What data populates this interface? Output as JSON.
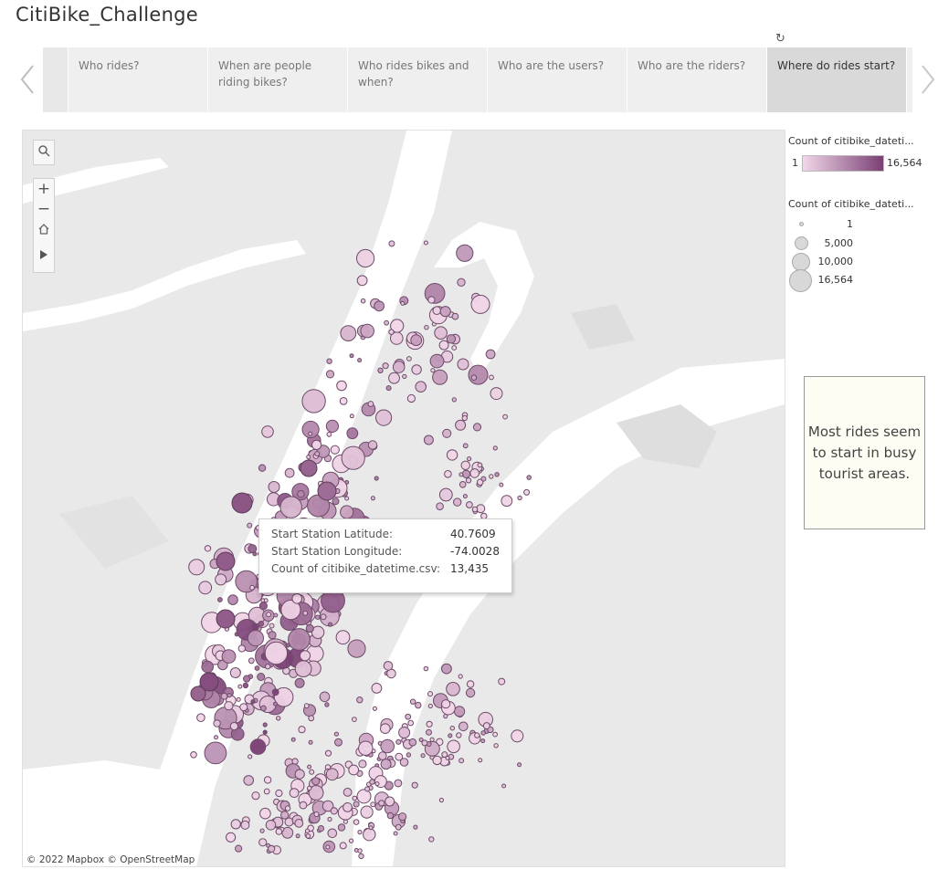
{
  "title": "CitiBike_Challenge",
  "story": {
    "tabs": [
      {
        "label": "Who rides?",
        "active": false
      },
      {
        "label": "When are people riding bikes?",
        "active": false
      },
      {
        "label": "Who rides bikes and when?",
        "active": false
      },
      {
        "label": "Who are the users?",
        "active": false
      },
      {
        "label": "Who are the riders?",
        "active": false
      },
      {
        "label": "Where do rides start?",
        "active": true
      }
    ]
  },
  "tooltip": {
    "rows": [
      {
        "key": "Start Station Latitude:",
        "value": "40.7609"
      },
      {
        "key": "Start Station Longitude:",
        "value": "-74.0028"
      },
      {
        "key": "Count of citibike_datetime.csv:",
        "value": "13,435"
      }
    ]
  },
  "map": {
    "credit": "© 2022 Mapbox  © OpenStreetMap",
    "tools": [
      "search-icon",
      "zoom-in-icon",
      "zoom-out-icon",
      "home-icon",
      "play-icon"
    ]
  },
  "legend": {
    "color_title": "Count of citibike_dateti...",
    "color_min": "1",
    "color_max": "16,564",
    "colors": {
      "low": "#f1d6e8",
      "high": "#7a3f74"
    },
    "size_title": "Count of citibike_dateti...",
    "size_items": [
      {
        "label": "1",
        "value": 1
      },
      {
        "label": "5,000",
        "value": 5000
      },
      {
        "label": "10,000",
        "value": 10000
      },
      {
        "label": "16,564",
        "value": 16564
      }
    ]
  },
  "note": "Most rides seem to start in busy tourist areas."
}
